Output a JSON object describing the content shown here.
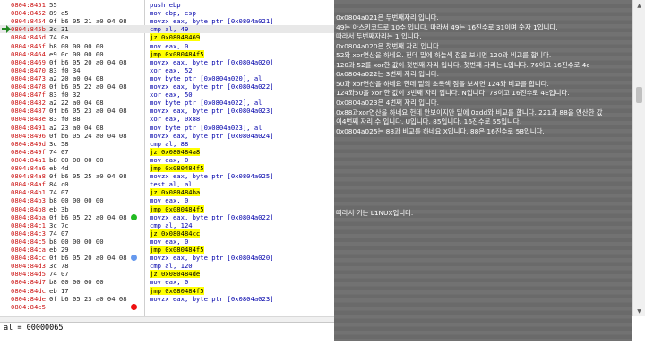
{
  "disassembly": {
    "rows": [
      {
        "addr": "0804:8451",
        "bytes": "55",
        "instr": "push ebp",
        "style": "push"
      },
      {
        "addr": "0804:8452",
        "bytes": "89 e5",
        "instr": "mov ebp, esp",
        "style": ""
      },
      {
        "addr": "0804:8454",
        "bytes": "0f b6 05 21 a0 04 08",
        "instr": "movzx eax, byte ptr [0x0804a021]",
        "style": ""
      },
      {
        "addr": "0804:845b",
        "bytes": "3c 31",
        "instr": "cmp al, 49",
        "style": "",
        "current": true
      },
      {
        "addr": "0804:845d",
        "bytes": "74 0a",
        "instr": "jz 0x08048469",
        "style": "jmp"
      },
      {
        "addr": "0804:845f",
        "bytes": "b8 00 00 00 00",
        "instr": "mov eax, 0",
        "style": ""
      },
      {
        "addr": "0804:8464",
        "bytes": "e9 0c 00 00 00",
        "instr": "jmp 0x080484f5",
        "style": "jmp"
      },
      {
        "addr": "0804:8469",
        "bytes": "0f b6 05 20 a0 04 08",
        "instr": "movzx eax, byte ptr [0x0804a020]",
        "style": ""
      },
      {
        "addr": "0804:8470",
        "bytes": "83 f0 34",
        "instr": "xor eax, 52",
        "style": ""
      },
      {
        "addr": "0804:8473",
        "bytes": "a2 20 a0 04 08",
        "instr": "mov byte ptr [0x0804a020], al",
        "style": ""
      },
      {
        "addr": "0804:8478",
        "bytes": "0f b6 05 22 a0 04 08",
        "instr": "movzx eax, byte ptr [0x0804a022]",
        "style": ""
      },
      {
        "addr": "0804:847f",
        "bytes": "83 f0 32",
        "instr": "xor eax, 50",
        "style": ""
      },
      {
        "addr": "0804:8482",
        "bytes": "a2 22 a0 04 08",
        "instr": "mov byte ptr [0x0804a022], al",
        "style": ""
      },
      {
        "addr": "0804:8487",
        "bytes": "0f b6 05 23 a0 04 08",
        "instr": "movzx eax, byte ptr [0x0804a023]",
        "style": ""
      },
      {
        "addr": "0804:848e",
        "bytes": "83 f0 88",
        "instr": "xor eax, 0x88",
        "style": ""
      },
      {
        "addr": "0804:8491",
        "bytes": "a2 23 a0 04 08",
        "instr": "mov byte ptr [0x0804a023], al",
        "style": ""
      },
      {
        "addr": "0804:8496",
        "bytes": "0f b6 05 24 a0 04 08",
        "instr": "movzx eax, byte ptr [0x0804a024]",
        "style": ""
      },
      {
        "addr": "0804:849d",
        "bytes": "3c 58",
        "instr": "cmp al, 88",
        "style": ""
      },
      {
        "addr": "0804:849f",
        "bytes": "74 07",
        "instr": "jz 0x080484a8",
        "style": "jmp"
      },
      {
        "addr": "0804:84a1",
        "bytes": "b8 00 00 00 00",
        "instr": "mov eax, 0",
        "style": ""
      },
      {
        "addr": "0804:84a6",
        "bytes": "eb 4d",
        "instr": "jmp 0x080484f5",
        "style": "jmp"
      },
      {
        "addr": "0804:84a8",
        "bytes": "0f b6 05 25 a0 04 08",
        "instr": "movzx eax, byte ptr [0x0804a025]",
        "style": ""
      },
      {
        "addr": "0804:84af",
        "bytes": "84 c0",
        "instr": "test al, al",
        "style": ""
      },
      {
        "addr": "0804:84b1",
        "bytes": "74 07",
        "instr": "jz 0x080484ba",
        "style": "jmp"
      },
      {
        "addr": "0804:84b3",
        "bytes": "b8 00 00 00 00",
        "instr": "mov eax, 0",
        "style": ""
      },
      {
        "addr": "0804:84b8",
        "bytes": "eb 3b",
        "instr": "jmp 0x080484f5",
        "style": "jmp"
      },
      {
        "addr": "0804:84ba",
        "bytes": "0f b6 05 22 a0 04 08",
        "instr": "movzx eax, byte ptr [0x0804a022]",
        "style": "",
        "bp": "green"
      },
      {
        "addr": "0804:84c1",
        "bytes": "3c 7c",
        "instr": "cmp al, 124",
        "style": ""
      },
      {
        "addr": "0804:84c3",
        "bytes": "74 07",
        "instr": "jz 0x080484cc",
        "style": "jmp"
      },
      {
        "addr": "0804:84c5",
        "bytes": "b8 00 00 00 00",
        "instr": "mov eax, 0",
        "style": ""
      },
      {
        "addr": "0804:84ca",
        "bytes": "eb 29",
        "instr": "jmp 0x080484f5",
        "style": "jmp"
      },
      {
        "addr": "0804:84cc",
        "bytes": "0f b6 05 20 a0 04 08",
        "instr": "movzx eax, byte ptr [0x0804a020]",
        "style": "",
        "bp": "blue"
      },
      {
        "addr": "0804:84d3",
        "bytes": "3c 78",
        "instr": "cmp al, 120",
        "style": ""
      },
      {
        "addr": "0804:84d5",
        "bytes": "74 07",
        "instr": "jz 0x080484de",
        "style": "jmp"
      },
      {
        "addr": "0804:84d7",
        "bytes": "b8 00 00 00 00",
        "instr": "mov eax, 0",
        "style": ""
      },
      {
        "addr": "0804:84dc",
        "bytes": "eb 17",
        "instr": "jmp 0x080484f5",
        "style": "jmp"
      },
      {
        "addr": "0804:84de",
        "bytes": "0f b6 05 23 a0 04 08",
        "instr": "movzx eax, byte ptr [0x0804a023]",
        "style": ""
      },
      {
        "addr": "0804:84e5",
        "bytes": "",
        "instr": "",
        "style": "",
        "bp": "red"
      }
    ]
  },
  "status": {
    "text": "al = 00000065"
  },
  "notes": {
    "lines": [
      "0x0804a021은 두번째자리 입니다.",
      "49는 아스키코드로 10수 입니다. 따라서 49는 16진수로 31이며 숫자 1입니다.",
      "따라서 두번째자리는 1 입니다.",
      "0x0804a020은 첫번째 자리 입니다.",
      "52와 xor연산을 하네요. 헌데 밑에 하늘색 점을 보시면 120과 비교를 합니다.",
      "120과 52를 xor한 값이 첫번째 자리 입니다. 첫번째 자리는 L입니다. 76이고 16진수로 4c",
      "0x0804a022는 3번째 자리 입니다.",
      "50과 xor연산을 하네요 헌데 밑의 초록색 점을 보시면 124와 비교를 합니다.",
      "124와50을 xor 한 값이 3번째 자리 입니다. N입니다. 78이고 16진수로 4E입니다.",
      "0x0804a023은 4번째 자리 입니다.",
      "0x88과xor연산을 하네요 헌데 안보이지만 밑에 0xdd와 비교를 합니다. 221과 88을 연산한 값",
      "이4번째 자리 수 입니다. U입니다. 85입니다. 16진수로 55입니다.",
      "0x0804a025는 88과 비교를 하네요 X입니다. 88은 16진수로 58입니다."
    ],
    "conclusion": "따라서 키는 L1NUX입니다."
  },
  "scrollbar": {
    "up": "▲",
    "down": "▼"
  },
  "colors": {
    "address": "#cc1111",
    "instruction": "#0000aa",
    "jump_highlight": "#ffff00",
    "notes_bg": "#6e6e6e",
    "bp_green": "#22bb22",
    "bp_blue": "#6699ee",
    "bp_red": "#ee1111",
    "ip_arrow": "#228822"
  }
}
